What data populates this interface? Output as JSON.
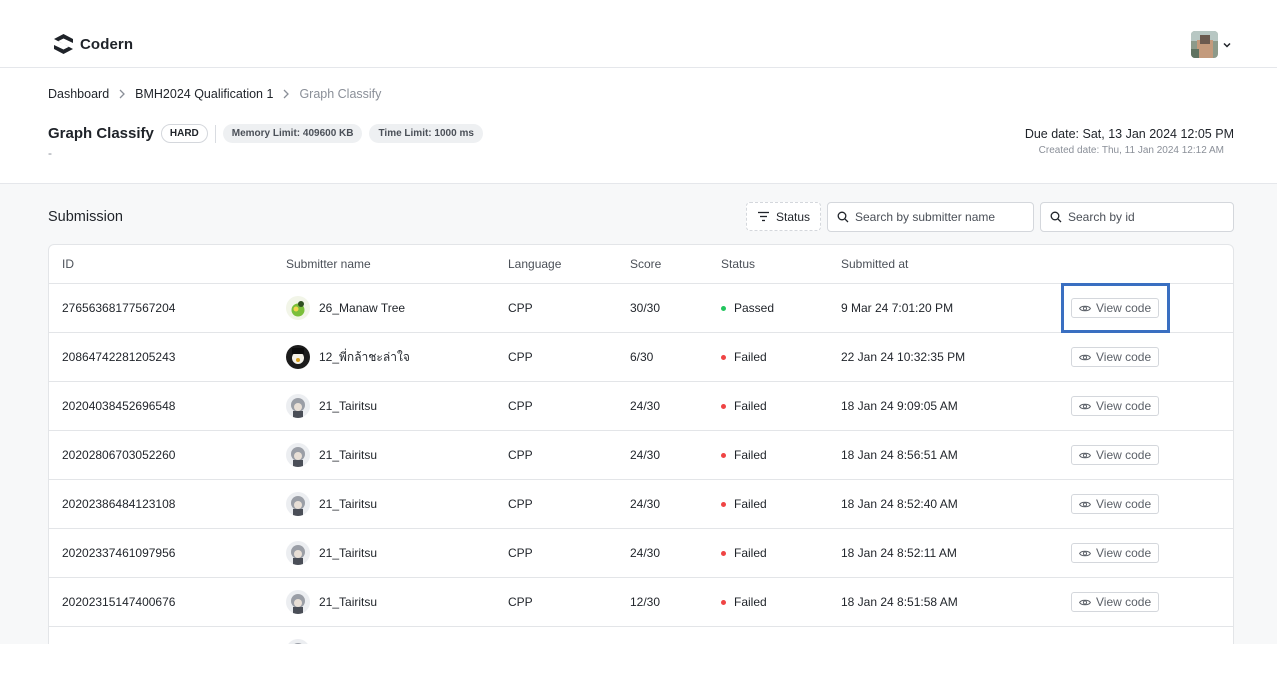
{
  "app": {
    "brand": "Codern"
  },
  "header": {
    "breadcrumb": [
      "Dashboard",
      "BMH2024 Qualification 1",
      "Graph Classify"
    ],
    "title": "Graph Classify",
    "difficulty": "HARD",
    "memory_limit": "Memory Limit: 409600 KB",
    "time_limit": "Time Limit: 1000 ms",
    "subtitle": "-",
    "due_date": "Due date: Sat, 13 Jan 2024 12:05 PM",
    "created_date": "Created date: Thu, 11 Jan 2024 12:12 AM"
  },
  "submission": {
    "title": "Submission",
    "status_filter_label": "Status",
    "search_name_placeholder": "Search by submitter name",
    "search_id_placeholder": "Search by id",
    "columns": [
      "ID",
      "Submitter name",
      "Language",
      "Score",
      "Status",
      "Submitted at"
    ],
    "view_label": "View code",
    "rows": [
      {
        "id": "27656368177567204",
        "name": "26_Manaw Tree",
        "language": "CPP",
        "score": "30/30",
        "status": "Passed",
        "submitted_at": "9 Mar 24 7:01:20 PM"
      },
      {
        "id": "20864742281205243",
        "name": "12_พี่กล้าชะล่าใจ",
        "language": "CPP",
        "score": "6/30",
        "status": "Failed",
        "submitted_at": "22 Jan 24 10:32:35 PM"
      },
      {
        "id": "20204038452696548",
        "name": "21_Tairitsu",
        "language": "CPP",
        "score": "24/30",
        "status": "Failed",
        "submitted_at": "18 Jan 24 9:09:05 AM"
      },
      {
        "id": "20202806703052260",
        "name": "21_Tairitsu",
        "language": "CPP",
        "score": "24/30",
        "status": "Failed",
        "submitted_at": "18 Jan 24 8:56:51 AM"
      },
      {
        "id": "20202386484123108",
        "name": "21_Tairitsu",
        "language": "CPP",
        "score": "24/30",
        "status": "Failed",
        "submitted_at": "18 Jan 24 8:52:40 AM"
      },
      {
        "id": "20202337461097956",
        "name": "21_Tairitsu",
        "language": "CPP",
        "score": "24/30",
        "status": "Failed",
        "submitted_at": "18 Jan 24 8:52:11 AM"
      },
      {
        "id": "20202315147400676",
        "name": "21_Tairitsu",
        "language": "CPP",
        "score": "12/30",
        "status": "Failed",
        "submitted_at": "18 Jan 24 8:51:58 AM"
      }
    ]
  },
  "colors": {
    "passed": "#22c55e",
    "failed": "#ef4444",
    "highlight": "#3a6fc1"
  }
}
